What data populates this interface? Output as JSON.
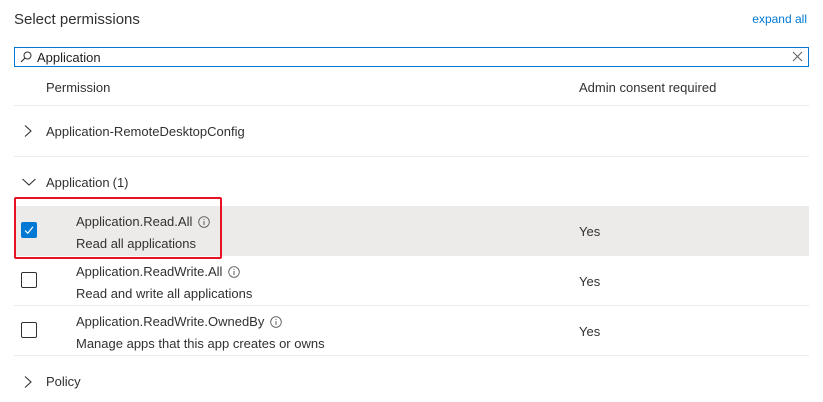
{
  "header": {
    "title": "Select permissions",
    "expand_all": "expand all"
  },
  "search": {
    "value": "Application",
    "placeholder": ""
  },
  "table": {
    "col_permission": "Permission",
    "col_admin": "Admin consent required"
  },
  "groups": [
    {
      "label": "Application-RemoteDesktopConfig",
      "expanded": false
    },
    {
      "label": "Application",
      "count": "(1)",
      "expanded": true
    },
    {
      "label": "Policy",
      "expanded": false
    }
  ],
  "permissions": [
    {
      "name": "Application.Read.All",
      "description": "Read all applications",
      "admin_consent": "Yes",
      "checked": true
    },
    {
      "name": "Application.ReadWrite.All",
      "description": "Read and write all applications",
      "admin_consent": "Yes",
      "checked": false
    },
    {
      "name": "Application.ReadWrite.OwnedBy",
      "description": "Manage apps that this app creates or owns",
      "admin_consent": "Yes",
      "checked": false
    }
  ],
  "colors": {
    "accent": "#0078d4",
    "highlight": "#e81123",
    "selected_row": "#edebe9"
  }
}
